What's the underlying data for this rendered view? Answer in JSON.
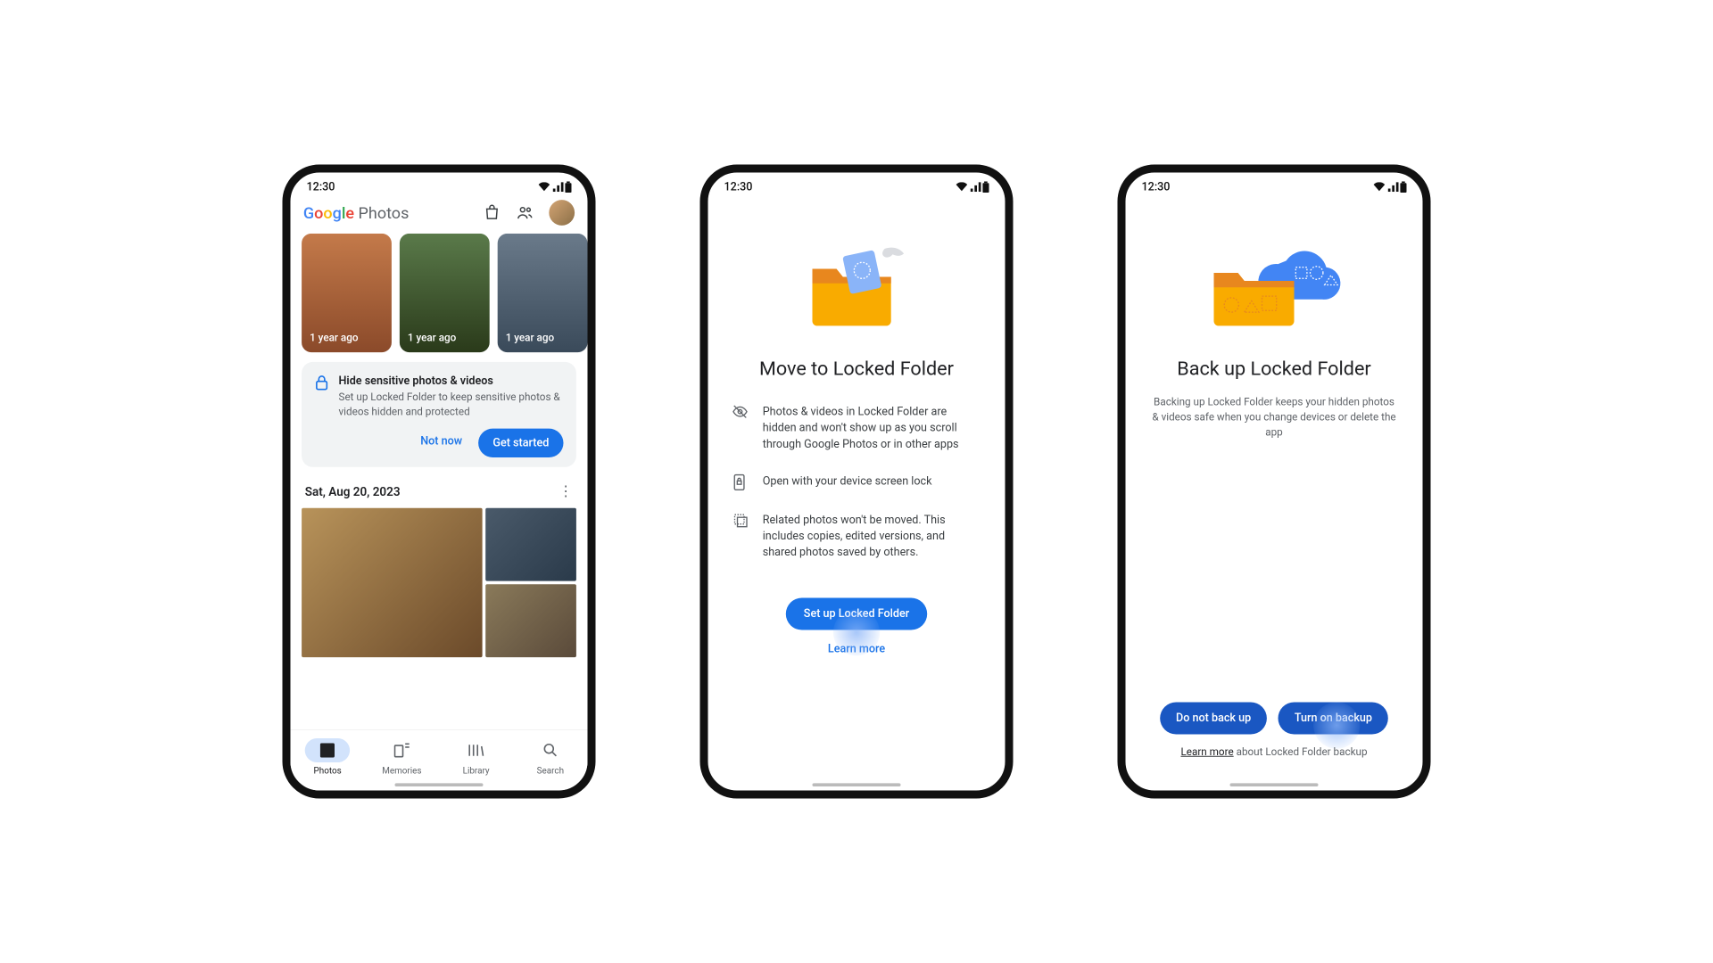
{
  "status": {
    "time": "12:30"
  },
  "phone1": {
    "logo_photos": "Photos",
    "memories": [
      {
        "label": "1 year ago"
      },
      {
        "label": "1 year ago"
      },
      {
        "label": "1 year ago"
      }
    ],
    "card": {
      "title": "Hide sensitive photos & videos",
      "desc": "Set up Locked Folder to keep sensitive photos & videos hidden and protected",
      "not_now": "Not now",
      "get_started": "Get started"
    },
    "date": "Sat, Aug 20, 2023",
    "nav": {
      "photos": "Photos",
      "memories": "Memories",
      "library": "Library",
      "search": "Search"
    }
  },
  "phone2": {
    "title": "Move to Locked Folder",
    "items": [
      "Photos & videos in Locked Folder are hidden and won't show up as you scroll through Google Photos or in other apps",
      "Open with your device screen lock",
      "Related photos won't be moved. This includes copies, edited versions, and shared photos saved by others."
    ],
    "cta": "Set up Locked Folder",
    "learn": "Learn more"
  },
  "phone3": {
    "title": "Back up Locked Folder",
    "desc": "Backing up Locked Folder keeps your hidden photos & videos safe when you change devices or delete the app",
    "do_not": "Do not back up",
    "turn_on": "Turn on backup",
    "learn_link": "Learn more",
    "learn_suffix": " about Locked Folder backup"
  }
}
